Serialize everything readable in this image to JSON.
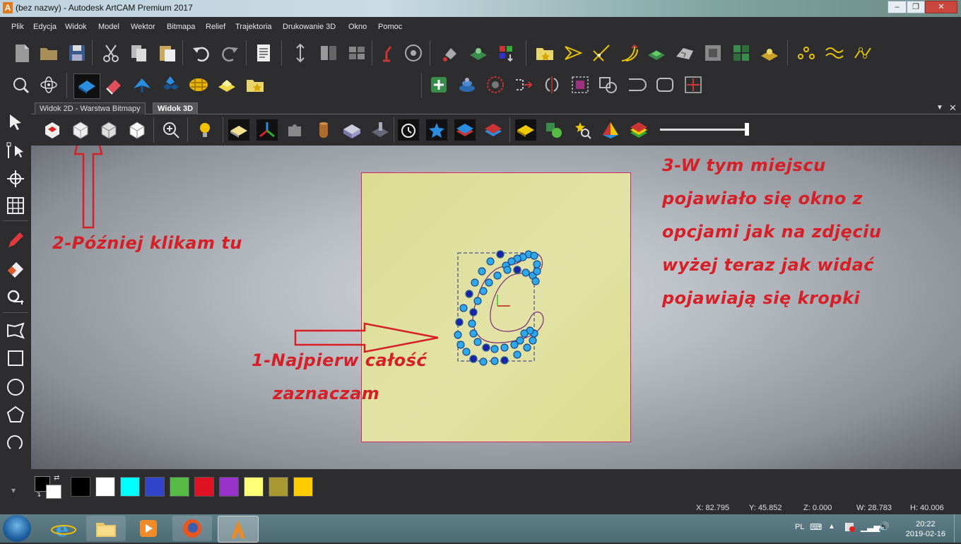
{
  "window": {
    "title": "(bez nazwy) - Autodesk ArtCAM Premium 2017",
    "app_icon": "A"
  },
  "menu": [
    "Plik",
    "Edycja",
    "Widok",
    "Model",
    "Wektor",
    "Bitmapa",
    "Relief",
    "Trajektoria",
    "Drukowanie 3D",
    "Okno",
    "Pomoc"
  ],
  "tabs": [
    {
      "label": "Widok 2D - Warstwa Bitmapy",
      "active": false
    },
    {
      "label": "Widok 3D",
      "active": true
    }
  ],
  "annotations": {
    "step1_line1": "1-Najpierw całość",
    "step1_line2": "zaznaczam",
    "step2": "2-Później klikam tu",
    "step3_lines": [
      "3-W tym miejscu",
      "pojawiało się okno z",
      "opcjami jak na zdjęciu",
      "wyżej teraz jak widać",
      "pojawiają się kropki"
    ],
    "color": "#d61f26"
  },
  "palette": {
    "colors": [
      "#000000",
      "#ffffff",
      "#00ffff",
      "#3344cc",
      "#55bb44",
      "#dd1122",
      "#9933cc",
      "#ffff77",
      "#aa9933",
      "#ffcc00"
    ]
  },
  "status": {
    "x": "X: 82.795",
    "y": "Y: 45.852",
    "z": "Z: 0.000",
    "w": "W: 28.783",
    "h": "H: 40.006"
  },
  "taskbar": {
    "language": "PL",
    "time": "20:22",
    "date": "2019-02-16"
  }
}
